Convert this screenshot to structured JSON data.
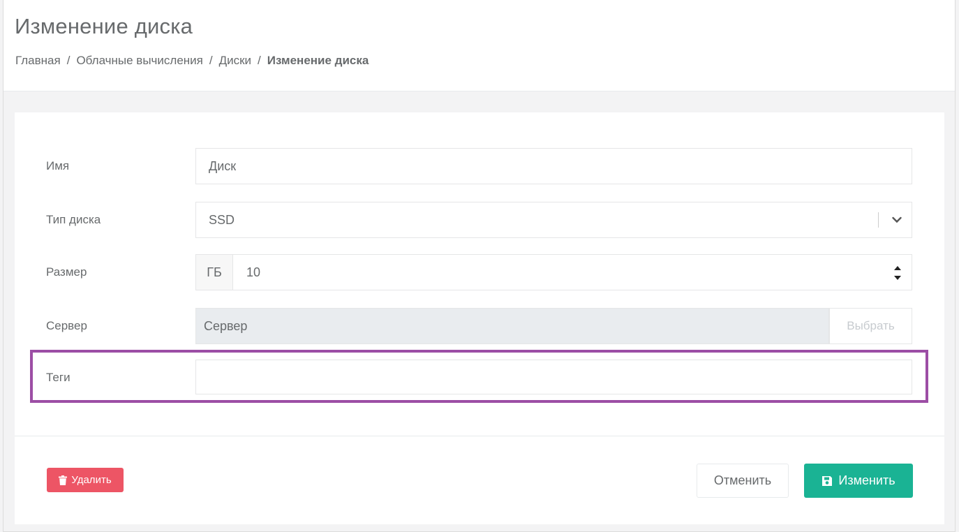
{
  "header": {
    "title": "Изменение диска",
    "breadcrumb": [
      "Главная",
      "Облачные вычисления",
      "Диски",
      "Изменение диска"
    ],
    "separator": "/"
  },
  "form": {
    "name": {
      "label": "Имя",
      "value": "Диск"
    },
    "disk_type": {
      "label": "Тип диска",
      "value": "SSD"
    },
    "size": {
      "label": "Размер",
      "unit": "ГБ",
      "value": "10"
    },
    "server": {
      "label": "Сервер",
      "value": "Сервер",
      "button": "Выбрать"
    },
    "tags": {
      "label": "Теги",
      "value": ""
    }
  },
  "actions": {
    "delete": "Удалить",
    "cancel": "Отменить",
    "save": "Изменить"
  },
  "colors": {
    "highlight": "#9c4ea5",
    "delete": "#ed5565",
    "save": "#1ab394"
  },
  "icons": {
    "delete": "trash-icon",
    "save": "floppy-disk-icon",
    "select": "chevron-down-icon",
    "spinner": "spinner-arrows-icon"
  }
}
